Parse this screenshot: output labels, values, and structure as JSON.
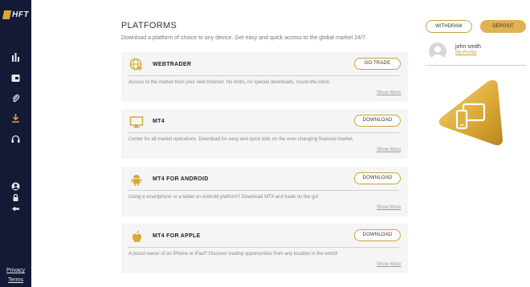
{
  "app": {
    "logo_text": "HFT"
  },
  "sidebar": {
    "icons": [
      "chart-icon",
      "wallet-icon",
      "attachment-icon",
      "download-icon",
      "headset-icon",
      "user-icon",
      "lock-icon",
      "logout-icon"
    ],
    "footer": {
      "privacy_label": "Privacy",
      "terms_label": "Terms"
    }
  },
  "page": {
    "title": "PLATFORMS",
    "subtitle": "Download a platform of choice to any device. Get easy and quick access to the global market 24/7."
  },
  "platforms": [
    {
      "name": "WEBTRADER",
      "icon": "globe-cursor-icon",
      "button_label": "GO TRADE",
      "description": "Access to the market from your web browser. No limits, no special downloads, round-the-clock.",
      "more_label": "Show More"
    },
    {
      "name": "MT4",
      "icon": "monitor-icon",
      "button_label": "DOWNLOAD",
      "description": "Center for all market operations. Download for easy and quick bids on the ever-changing financial market.",
      "more_label": "Show More"
    },
    {
      "name": "MT4 FOR ANDROID",
      "icon": "android-icon",
      "button_label": "DOWNLOAD",
      "description": "Using a smartphone or a tablet on Android platform? Download MT4 and trade on the go!",
      "more_label": "Show More"
    },
    {
      "name": "MT4 FOR APPLE",
      "icon": "apple-icon",
      "button_label": "DOWNLOAD",
      "description": "A proud owner of an iPhone or iPad? Discover trading opportunities from any location in the world!",
      "more_label": "Show More"
    }
  ],
  "account": {
    "withdraw_label": "WITHDRAW",
    "deposit_label": "DEPOSIT",
    "user_name": "john smith",
    "profile_link": "My Profile"
  },
  "colors": {
    "sidebar": "#141a36",
    "accent": "#d9a832",
    "deposit": "#e0b254"
  }
}
